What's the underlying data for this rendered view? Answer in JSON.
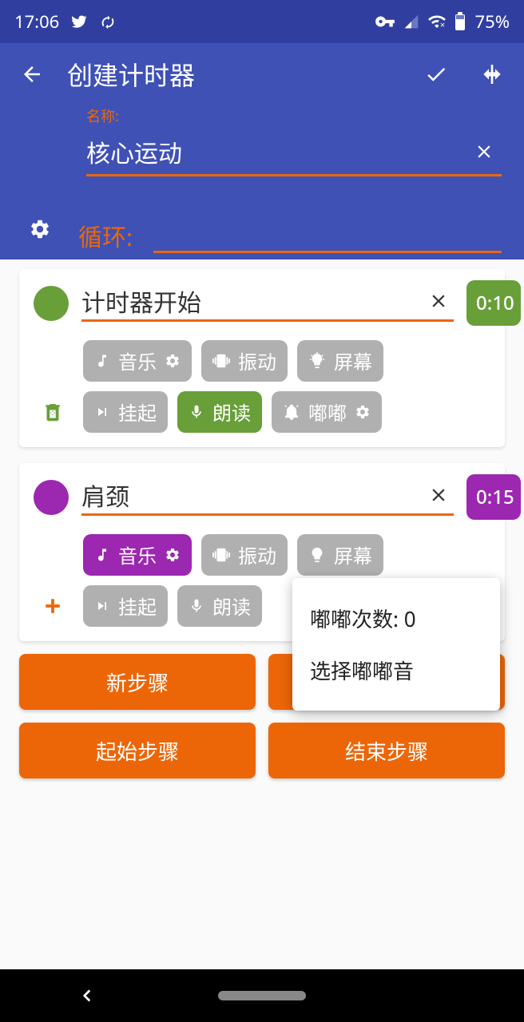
{
  "status": {
    "time": "17:06",
    "battery": "75%"
  },
  "header": {
    "title": "创建计时器"
  },
  "name": {
    "label": "名称:",
    "value": "核心运动"
  },
  "loop": {
    "label": "循环:"
  },
  "steps": [
    {
      "color": "green",
      "name": "计时器开始",
      "time": "0:10",
      "chips": {
        "music": "音乐",
        "vibrate": "振动",
        "screen": "屏幕",
        "suspend": "挂起",
        "speak": "朗读",
        "beep": "嘟嘟"
      },
      "chipActive": {
        "speak": true
      }
    },
    {
      "color": "purple",
      "name": "肩颈",
      "time": "0:15",
      "chips": {
        "music": "音乐",
        "vibrate": "振动",
        "screen": "屏幕",
        "suspend": "挂起",
        "speak": "朗读"
      },
      "chipActive": {
        "music": true
      }
    }
  ],
  "buttons": {
    "newStep": "新步骤",
    "startStep": "起始步骤",
    "endStep": "结束步骤"
  },
  "popup": {
    "beepCount": "嘟嘟次数: 0",
    "selectBeep": "选择嘟嘟音"
  }
}
